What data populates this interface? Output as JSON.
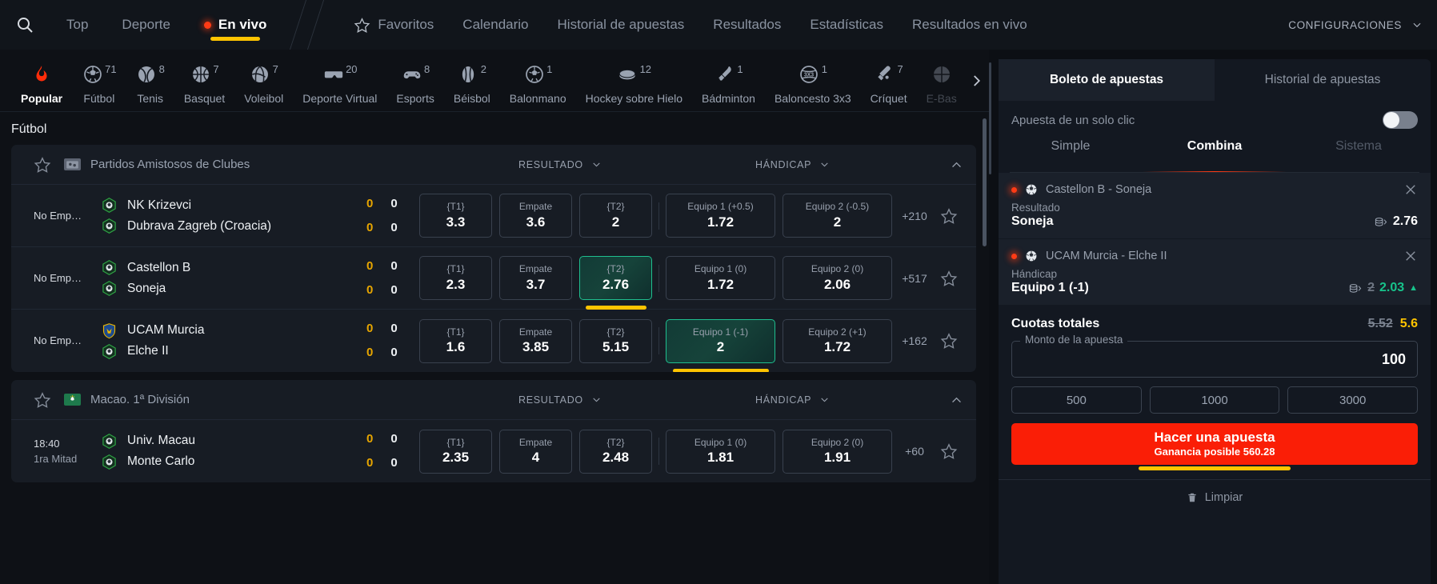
{
  "topnav": {
    "search_icon": "search-icon",
    "group_a": [
      {
        "label": "Top",
        "active": false,
        "live": false
      },
      {
        "label": "Deporte",
        "active": false,
        "live": false
      },
      {
        "label": "En vivo",
        "active": true,
        "live": true
      }
    ],
    "group_b": [
      {
        "label": "Favoritos",
        "icon": "star-icon"
      },
      {
        "label": "Calendario",
        "icon": null
      },
      {
        "label": "Historial de apuestas",
        "icon": null
      },
      {
        "label": "Resultados",
        "icon": null
      },
      {
        "label": "Estadísticas",
        "icon": null
      },
      {
        "label": "Resultados en vivo",
        "icon": null
      }
    ],
    "settings_label": "CONFIGURACIONES",
    "settings_icon": "chevron-down-icon"
  },
  "sports": [
    {
      "label": "Popular",
      "count": "",
      "icon": "flame-icon",
      "active": true
    },
    {
      "label": "Fútbol",
      "count": "71",
      "icon": "soccer-icon",
      "active": false
    },
    {
      "label": "Tenis",
      "count": "8",
      "icon": "tennis-icon",
      "active": false
    },
    {
      "label": "Basquet",
      "count": "7",
      "icon": "basketball-icon",
      "active": false
    },
    {
      "label": "Voleibol",
      "count": "7",
      "icon": "volleyball-icon",
      "active": false
    },
    {
      "label": "Deporte Virtual",
      "count": "20",
      "icon": "vr-headset-icon",
      "active": false
    },
    {
      "label": "Esports",
      "count": "8",
      "icon": "gamepad-icon",
      "active": false
    },
    {
      "label": "Béisbol",
      "count": "2",
      "icon": "baseball-icon",
      "active": false
    },
    {
      "label": "Balonmano",
      "count": "1",
      "icon": "handball-icon",
      "active": false
    },
    {
      "label": "Hockey sobre Hielo",
      "count": "12",
      "icon": "hockey-puck-icon",
      "active": false
    },
    {
      "label": "Bádminton",
      "count": "1",
      "icon": "shuttlecock-icon",
      "active": false
    },
    {
      "label": "Baloncesto 3x3",
      "count": "1",
      "icon": "basketball3x3-icon",
      "active": false
    },
    {
      "label": "Críquet",
      "count": "7",
      "icon": "cricket-icon",
      "active": false
    },
    {
      "label": "E-Bas",
      "count": "",
      "icon": "ebasket-icon",
      "active": false
    }
  ],
  "section_title": "Fútbol",
  "column_headers": {
    "resultado": "RESULTADO",
    "handicap": "HÁNDICAP"
  },
  "leagues": [
    {
      "name": "Partidos Amistosos de Clubes",
      "flag": "friendly-flag",
      "rows": [
        {
          "time_1": "No Emp…",
          "time_2": "",
          "home": "NK Krizevci",
          "away": "Dubrava Zagreb (Croacia)",
          "home_logo": "soccer-crest-green",
          "away_logo": "soccer-crest-green",
          "score_home_a": "0",
          "score_home_b": "0",
          "score_away_a": "0",
          "score_away_b": "0",
          "odds_result": [
            {
              "label": "{T1}",
              "value": "3.3",
              "selected": false
            },
            {
              "label": "Empate",
              "value": "3.6",
              "selected": false
            },
            {
              "label": "{T2}",
              "value": "2",
              "selected": false
            }
          ],
          "odds_handicap": [
            {
              "label": "Equipo 1 (+0.5)",
              "value": "1.72",
              "selected": false
            },
            {
              "label": "Equipo 2 (-0.5)",
              "value": "2",
              "selected": false
            }
          ],
          "more": "+210"
        },
        {
          "time_1": "No Emp…",
          "time_2": "",
          "home": "Castellon B",
          "away": "Soneja",
          "home_logo": "soccer-crest-green",
          "away_logo": "soccer-crest-green",
          "score_home_a": "0",
          "score_home_b": "0",
          "score_away_a": "0",
          "score_away_b": "0",
          "odds_result": [
            {
              "label": "{T1}",
              "value": "2.3",
              "selected": false
            },
            {
              "label": "Empate",
              "value": "3.7",
              "selected": false
            },
            {
              "label": "{T2}",
              "value": "2.76",
              "selected": true
            }
          ],
          "odds_handicap": [
            {
              "label": "Equipo 1 (0)",
              "value": "1.72",
              "selected": false
            },
            {
              "label": "Equipo 2 (0)",
              "value": "2.06",
              "selected": false
            }
          ],
          "more": "+517"
        },
        {
          "time_1": "No Emp…",
          "time_2": "",
          "home": "UCAM Murcia",
          "away": "Elche II",
          "home_logo": "shield-blue-yellow",
          "away_logo": "soccer-crest-green",
          "score_home_a": "0",
          "score_home_b": "0",
          "score_away_a": "0",
          "score_away_b": "0",
          "odds_result": [
            {
              "label": "{T1}",
              "value": "1.6",
              "selected": false
            },
            {
              "label": "Empate",
              "value": "3.85",
              "selected": false
            },
            {
              "label": "{T2}",
              "value": "5.15",
              "selected": false
            }
          ],
          "odds_handicap": [
            {
              "label": "Equipo 1 (-1)",
              "value": "2",
              "selected": true
            },
            {
              "label": "Equipo 2 (+1)",
              "value": "1.72",
              "selected": false
            }
          ],
          "more": "+162"
        }
      ]
    },
    {
      "name": "Macao. 1ª División",
      "flag": "macao-flag",
      "rows": [
        {
          "time_1": "18:40",
          "time_2": "1ra Mitad",
          "home": "Univ. Macau",
          "away": "Monte Carlo",
          "home_logo": "soccer-crest-green",
          "away_logo": "soccer-crest-green",
          "score_home_a": "0",
          "score_home_b": "0",
          "score_away_a": "0",
          "score_away_b": "0",
          "odds_result": [
            {
              "label": "{T1}",
              "value": "2.35",
              "selected": false
            },
            {
              "label": "Empate",
              "value": "4",
              "selected": false
            },
            {
              "label": "{T2}",
              "value": "2.48",
              "selected": false
            }
          ],
          "odds_handicap": [
            {
              "label": "Equipo 1 (0)",
              "value": "1.81",
              "selected": false
            },
            {
              "label": "Equipo 2 (0)",
              "value": "1.91",
              "selected": false
            }
          ],
          "more": "+60"
        }
      ]
    }
  ],
  "betslip": {
    "tabs": [
      {
        "label": "Boleto de apuestas",
        "active": true
      },
      {
        "label": "Historial de apuestas",
        "active": false
      }
    ],
    "oneclick_label": "Apuesta de un solo clic",
    "oneclick_on": false,
    "modes": [
      {
        "label": "Simple",
        "active": false,
        "disabled": false
      },
      {
        "label": "Combina",
        "active": true,
        "disabled": false
      },
      {
        "label": "Sistema",
        "active": false,
        "disabled": true
      }
    ],
    "selections": [
      {
        "match": "Castellon B - Soneja",
        "market": "Resultado",
        "pick": "Soneja",
        "odd_old": "",
        "odd_new": "2.76",
        "odd_trend": "",
        "live": true,
        "close_icon": "close-icon"
      },
      {
        "match": "UCAM Murcia - Elche II",
        "market": "Hándicap",
        "pick": "Equipo 1 (-1)",
        "odd_old": "2",
        "odd_new": "2.03",
        "odd_trend": "up",
        "live": true,
        "close_icon": "close-icon"
      }
    ],
    "totals_label": "Cuotas totales",
    "totals_old": "5.52",
    "totals_new": "5.6",
    "stake_legend": "Monto de la apuesta",
    "stake_value": "100",
    "quick_amounts": [
      "500",
      "1000",
      "3000"
    ],
    "place_bet_title": "Hacer una apuesta",
    "place_bet_sub": "Ganancia posible 560.28",
    "clear_label": "Limpiar",
    "clear_icon": "trash-icon"
  },
  "colors": {
    "accent_yellow": "#ffc400",
    "accent_red": "#fa1e06",
    "accent_green": "#17c38b",
    "panel_bg": "#131821",
    "card_bg": "#171c24"
  }
}
